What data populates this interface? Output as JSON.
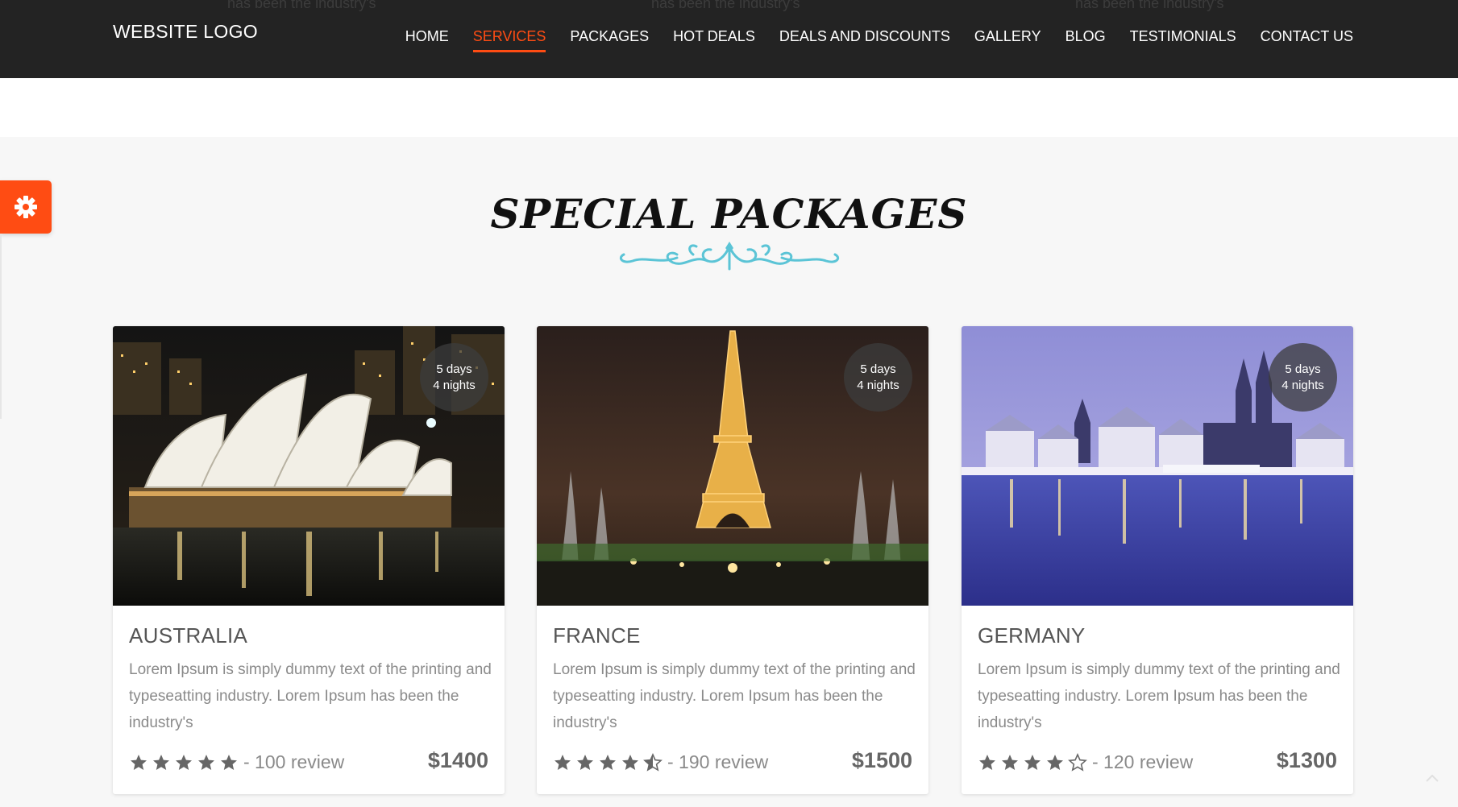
{
  "header": {
    "ghost_text": [
      "has been the industry's",
      "has been the industry's",
      "has been the industry's"
    ],
    "logo": "WEBSITE LOGO",
    "nav": [
      {
        "label": "HOME",
        "active": false
      },
      {
        "label": "SERVICES",
        "active": true
      },
      {
        "label": "PACKAGES",
        "active": false
      },
      {
        "label": "HOT DEALS",
        "active": false
      },
      {
        "label": "DEALS AND DISCOUNTS",
        "active": false
      },
      {
        "label": "GALLERY",
        "active": false
      },
      {
        "label": "BLOG",
        "active": false
      },
      {
        "label": "TESTIMONIALS",
        "active": false
      },
      {
        "label": "CONTACT US",
        "active": false
      }
    ]
  },
  "settings": {
    "icon": "gear-icon"
  },
  "section": {
    "title": "SPECIAL PACKAGES"
  },
  "packages": [
    {
      "title": "AUSTRALIA",
      "days": "5 days",
      "nights": "4 nights",
      "description": "Lorem Ipsum is simply dummy text of the printing and typeseatting industry. Lorem Ipsum has been the industry's",
      "rating": 5,
      "reviews": "- 100 review",
      "price": "$1400",
      "image": "sydney-opera-house-night"
    },
    {
      "title": "FRANCE",
      "days": "5 days",
      "nights": "4 nights",
      "description": "Lorem Ipsum is simply dummy text of the printing and typeseatting industry. Lorem Ipsum has been the industry's",
      "rating": 4.5,
      "reviews": "- 190 review",
      "price": "$1500",
      "image": "eiffel-tower-night"
    },
    {
      "title": "GERMANY",
      "days": "5 days",
      "nights": "4 nights",
      "description": "Lorem Ipsum is simply dummy text of the printing and typeseatting industry. Lorem Ipsum has been the industry's",
      "rating": 4,
      "reviews": "- 120 review",
      "price": "$1300",
      "image": "cologne-riverside-winter"
    }
  ],
  "colors": {
    "accent": "#ff4c13",
    "header_bg": "#232323",
    "ornament": "#5bc4d6",
    "star": "#666666"
  }
}
